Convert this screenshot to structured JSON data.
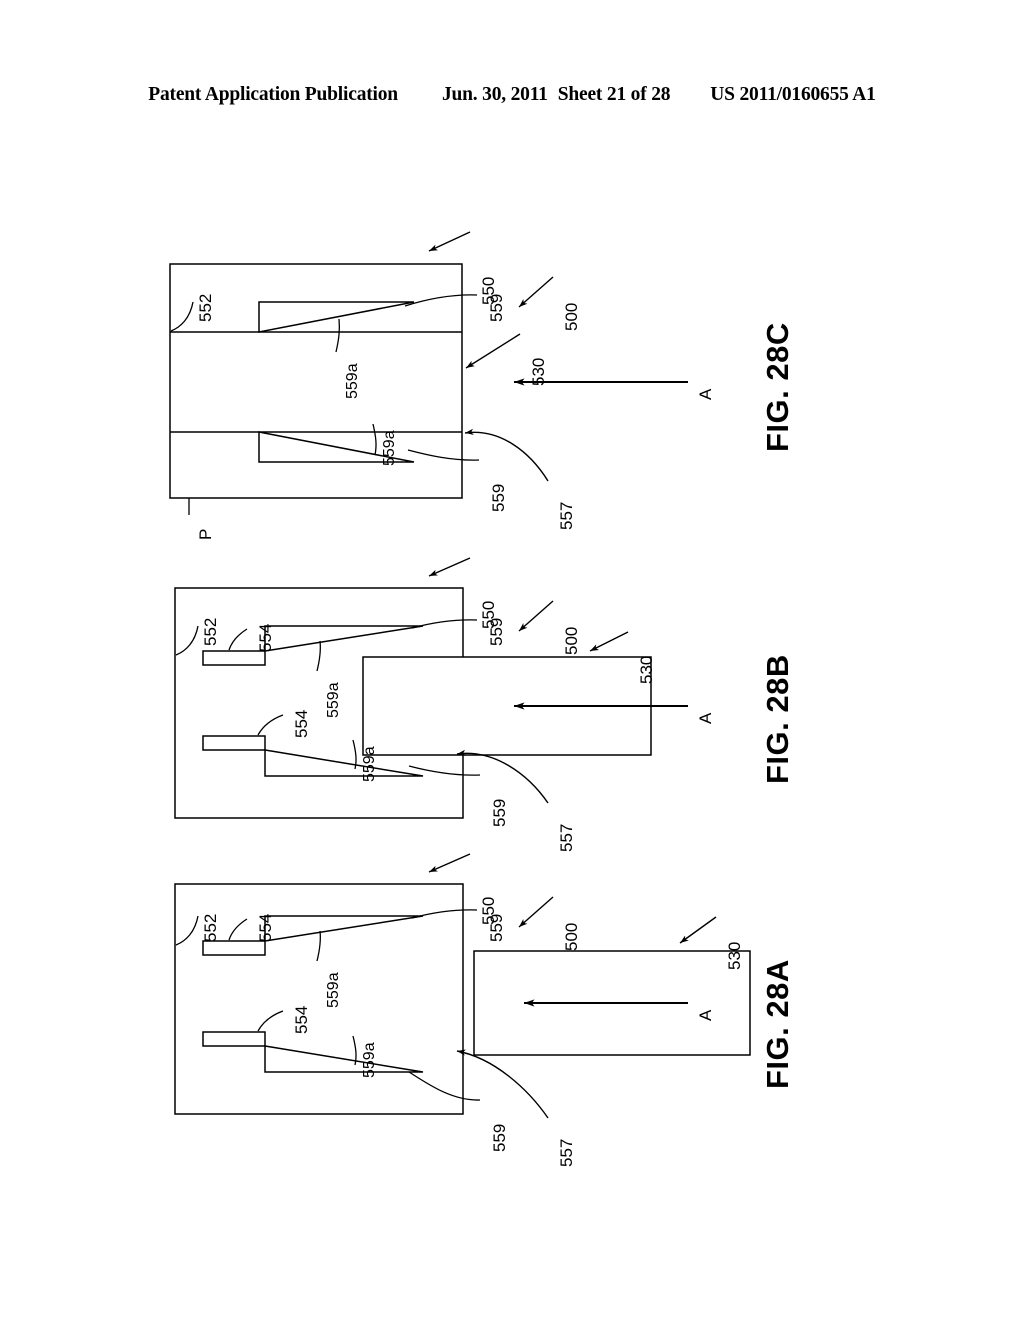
{
  "header": {
    "publication": "Patent Application Publication",
    "date": "Jun. 30, 2011",
    "sheet": "Sheet 21 of 28",
    "patent_number": "US 2011/0160655 A1"
  },
  "figures": [
    {
      "id": "fig-28c",
      "caption": "FIG. 28C",
      "state": "fully-inserted",
      "labels": {
        "housing": "550",
        "cavity_wall": "552",
        "assembly": "500",
        "insert_block": "530",
        "interface": "557",
        "tab_tip_upper": "559",
        "tab_tip_lower": "559",
        "taper_upper": "559a",
        "taper_lower": "559a",
        "plane": "P",
        "direction": "A"
      }
    },
    {
      "id": "fig-28b",
      "caption": "FIG. 28B",
      "state": "partially-inserted",
      "labels": {
        "housing": "550",
        "cavity_wall": "552",
        "assembly": "500",
        "insert_block": "530",
        "interface": "557",
        "tab_tip_upper": "559",
        "tab_tip_lower": "559",
        "taper_upper": "559a",
        "taper_lower": "559a",
        "pad_upper": "554",
        "pad_lower": "554",
        "direction": "A"
      }
    },
    {
      "id": "fig-28a",
      "caption": "FIG. 28A",
      "state": "separated",
      "labels": {
        "housing": "550",
        "cavity_wall": "552",
        "assembly": "500",
        "insert_block": "530",
        "interface": "557",
        "tab_tip_upper": "559",
        "tab_tip_lower": "559",
        "taper_upper": "559a",
        "taper_lower": "559a",
        "pad_upper": "554",
        "pad_lower": "554",
        "direction": "A"
      }
    }
  ],
  "style": {
    "line_color": "#000000",
    "fill_color": "#ffffff",
    "background": "#ffffff"
  }
}
